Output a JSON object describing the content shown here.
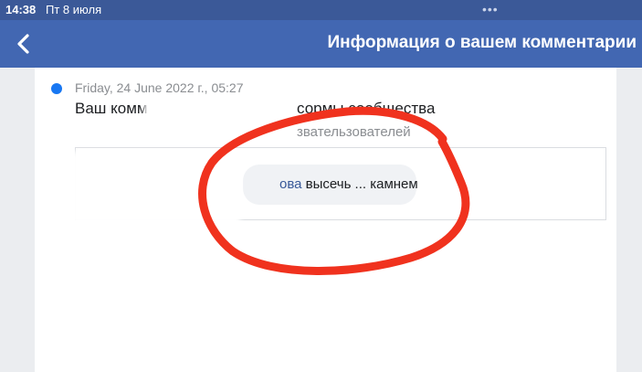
{
  "status_bar": {
    "time": "14:38",
    "date": "Пт 8 июля",
    "dots": "•••"
  },
  "nav": {
    "back_icon": "chevron-left-icon",
    "title": "Информация о вашем комментарии"
  },
  "notification": {
    "timestamp": "Friday, 24 June 2022 г., 05:27",
    "headline_visible_start": "Ваш комм",
    "headline_visible_end": "сормы сообщества",
    "subline": "звательзователей",
    "comment": {
      "name_fragment": "ова",
      "text": " высечь ... камнем"
    }
  },
  "colors": {
    "nav_background": "#4267b2",
    "unread_dot": "#1877f2",
    "annotation_red": "#f0321e"
  }
}
